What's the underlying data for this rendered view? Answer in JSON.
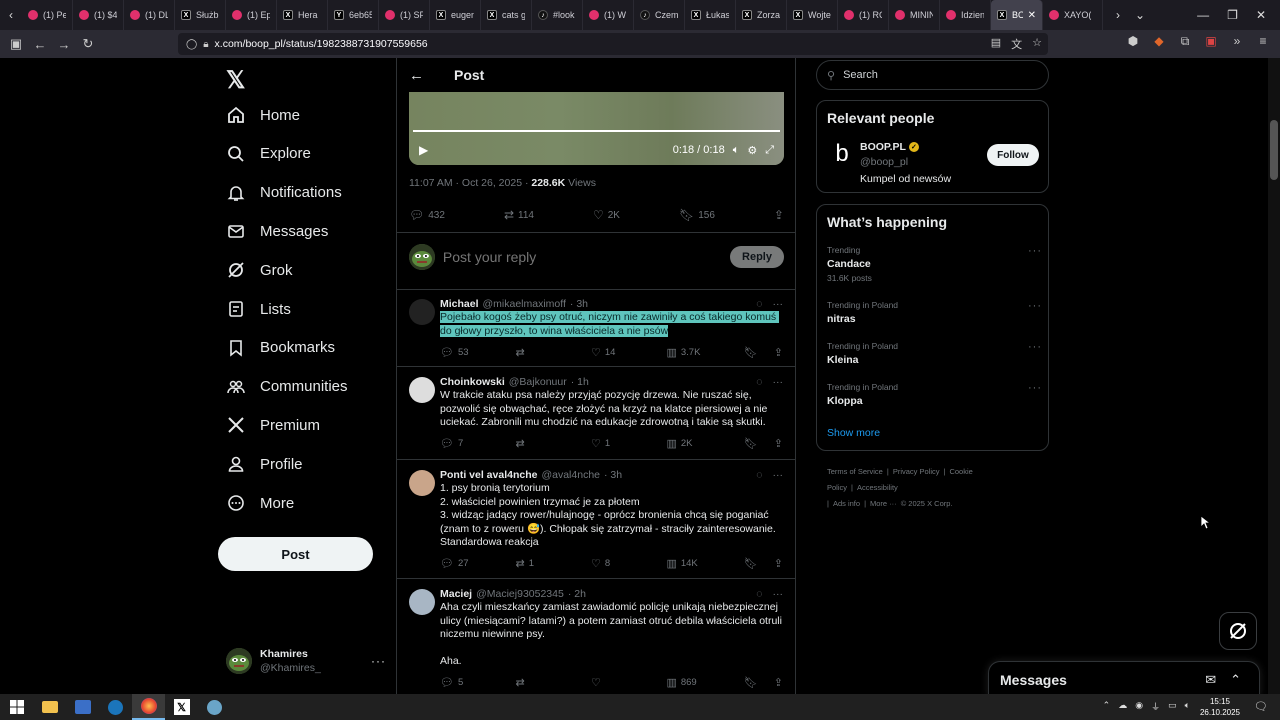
{
  "browser": {
    "tabs": [
      {
        "label": "(1) Pe",
        "fav": "yt",
        "glyph": ""
      },
      {
        "label": "(1) $4",
        "fav": "yt",
        "glyph": ""
      },
      {
        "label": "(1) DL",
        "fav": "yt",
        "glyph": ""
      },
      {
        "label": "Służb",
        "fav": "x",
        "glyph": "X"
      },
      {
        "label": "(1) Ep",
        "fav": "yt",
        "glyph": ""
      },
      {
        "label": "Hera",
        "fav": "x",
        "glyph": "X"
      },
      {
        "label": "6eb65",
        "fav": "x",
        "glyph": "Y"
      },
      {
        "label": "(1) SP",
        "fav": "yt",
        "glyph": ""
      },
      {
        "label": "eugen",
        "fav": "x",
        "glyph": "X"
      },
      {
        "label": "cats g",
        "fav": "x",
        "glyph": "X"
      },
      {
        "label": "#look",
        "fav": "tt",
        "glyph": "♪"
      },
      {
        "label": "(1) W",
        "fav": "yt",
        "glyph": ""
      },
      {
        "label": "Czem",
        "fav": "tt",
        "glyph": "♪"
      },
      {
        "label": "Łukas",
        "fav": "x",
        "glyph": "X"
      },
      {
        "label": "Zorza",
        "fav": "x",
        "glyph": "X"
      },
      {
        "label": "Wojte",
        "fav": "x",
        "glyph": "X"
      },
      {
        "label": "(1) RC",
        "fav": "yt",
        "glyph": ""
      },
      {
        "label": "MININ",
        "fav": "yt",
        "glyph": ""
      },
      {
        "label": "Idzien",
        "fav": "yt",
        "glyph": ""
      }
    ],
    "active_tab": {
      "label": "BO(",
      "glyph": "X"
    },
    "after_tab": {
      "label": "XAYO(",
      "fav": "yt"
    },
    "url": "x.com/boop_pl/status/1982388731907559656"
  },
  "nav": {
    "items": [
      {
        "key": "home",
        "label": "Home"
      },
      {
        "key": "explore",
        "label": "Explore"
      },
      {
        "key": "notifications",
        "label": "Notifications"
      },
      {
        "key": "messages",
        "label": "Messages"
      },
      {
        "key": "grok",
        "label": "Grok"
      },
      {
        "key": "lists",
        "label": "Lists"
      },
      {
        "key": "bookmarks",
        "label": "Bookmarks"
      },
      {
        "key": "communities",
        "label": "Communities"
      },
      {
        "key": "premium",
        "label": "Premium"
      },
      {
        "key": "profile",
        "label": "Profile"
      },
      {
        "key": "more",
        "label": "More"
      }
    ],
    "post_button": "Post",
    "user": {
      "name": "Khamires",
      "handle": "@Khamires_"
    }
  },
  "main": {
    "header": "Post",
    "video": {
      "time": "0:18 / 0:18",
      "progress": 1.0
    },
    "meta": {
      "time": "11:07 AM · Oct 26, 2025 · ",
      "views_count": "228.6K",
      "views_label": " Views"
    },
    "stats": {
      "replies": "432",
      "reposts": "114",
      "likes": "2K",
      "bookmarks": "156"
    },
    "reply_placeholder": "Post your reply",
    "reply_button": "Reply",
    "replies": [
      {
        "name": "Michael",
        "handle": "@mikaelmaximoff",
        "time": "· 3h",
        "text": "Pojebało kogoś żeby psy otruć, niczym nie zawiniły a coś takiego komuś do głowy przyszło, to wina właściciela a nie psów",
        "highlight": true,
        "acts": {
          "replies": "53",
          "reposts": "",
          "likes": "14",
          "views": "3.7K"
        }
      },
      {
        "name": "Choinkowski",
        "handle": "@Bajkonuur",
        "time": "· 1h",
        "text": "W trakcie ataku psa należy przyjąć pozycję drzewa. Nie ruszać się, pozwolić się obwąchać, ręce złożyć na krzyż na klatce piersiowej a nie uciekać. Zabronili mu chodzić na edukacje zdrowotną i takie są skutki.",
        "highlight": false,
        "acts": {
          "replies": "7",
          "reposts": "",
          "likes": "1",
          "views": "2K"
        }
      },
      {
        "name": "Ponti vel aval4nche",
        "handle": "@aval4nche",
        "time": "· 3h",
        "text": "1. psy bronią terytorium\n2. właściciel powinien trzymać je za płotem\n3. widząc jadący rower/hulajnogę - oprócz bronienia chcą się poganiać (znam to z roweru 😅). Chłopak się zatrzymał - straciły zainteresowanie.\nStandardowa reakcja",
        "highlight": false,
        "acts": {
          "replies": "27",
          "reposts": "1",
          "likes": "8",
          "views": "14K"
        }
      },
      {
        "name": "Maciej",
        "handle": "@Maciej93052345",
        "time": "· 2h",
        "text": "Aha czyli mieszkańcy zamiast zawiadomić policję unikają niebezpiecznej ulicy (miesiącami? latami?) a potem zamiast otruć debila właściciela otruli niczemu niewinne psy.\n\nAha.",
        "highlight": false,
        "acts": {
          "replies": "5",
          "reposts": "",
          "likes": "",
          "views": "869"
        }
      }
    ]
  },
  "right": {
    "search_placeholder": "Search",
    "relevant_people": {
      "title": "Relevant people",
      "name": "BOOP.PL",
      "handle": "@boop_pl",
      "bio": "Kumpel od newsów",
      "follow": "Follow"
    },
    "whats_happening": {
      "title": "What’s happening",
      "trends": [
        {
          "context": "Trending",
          "title": "Candace",
          "count": "31.6K posts"
        },
        {
          "context": "Trending in Poland",
          "title": "nitras",
          "count": ""
        },
        {
          "context": "Trending in Poland",
          "title": "Kleina",
          "count": ""
        },
        {
          "context": "Trending in Poland",
          "title": "Kloppa",
          "count": ""
        }
      ],
      "show_more": "Show more"
    },
    "footer": [
      "Terms of Service",
      "|",
      "Privacy Policy",
      "|",
      "Cookie Policy",
      "|",
      "Accessibility",
      "|",
      "Ads info",
      "|",
      "More ···",
      "© 2025 X Corp."
    ]
  },
  "messages_dock": {
    "title": "Messages"
  },
  "taskbar": {
    "time": "15:15",
    "date": "26.10.2025"
  },
  "colors": {
    "accent": "#1d9bf0",
    "highlight": "#5fc5bd",
    "verified": "#e2b719"
  }
}
